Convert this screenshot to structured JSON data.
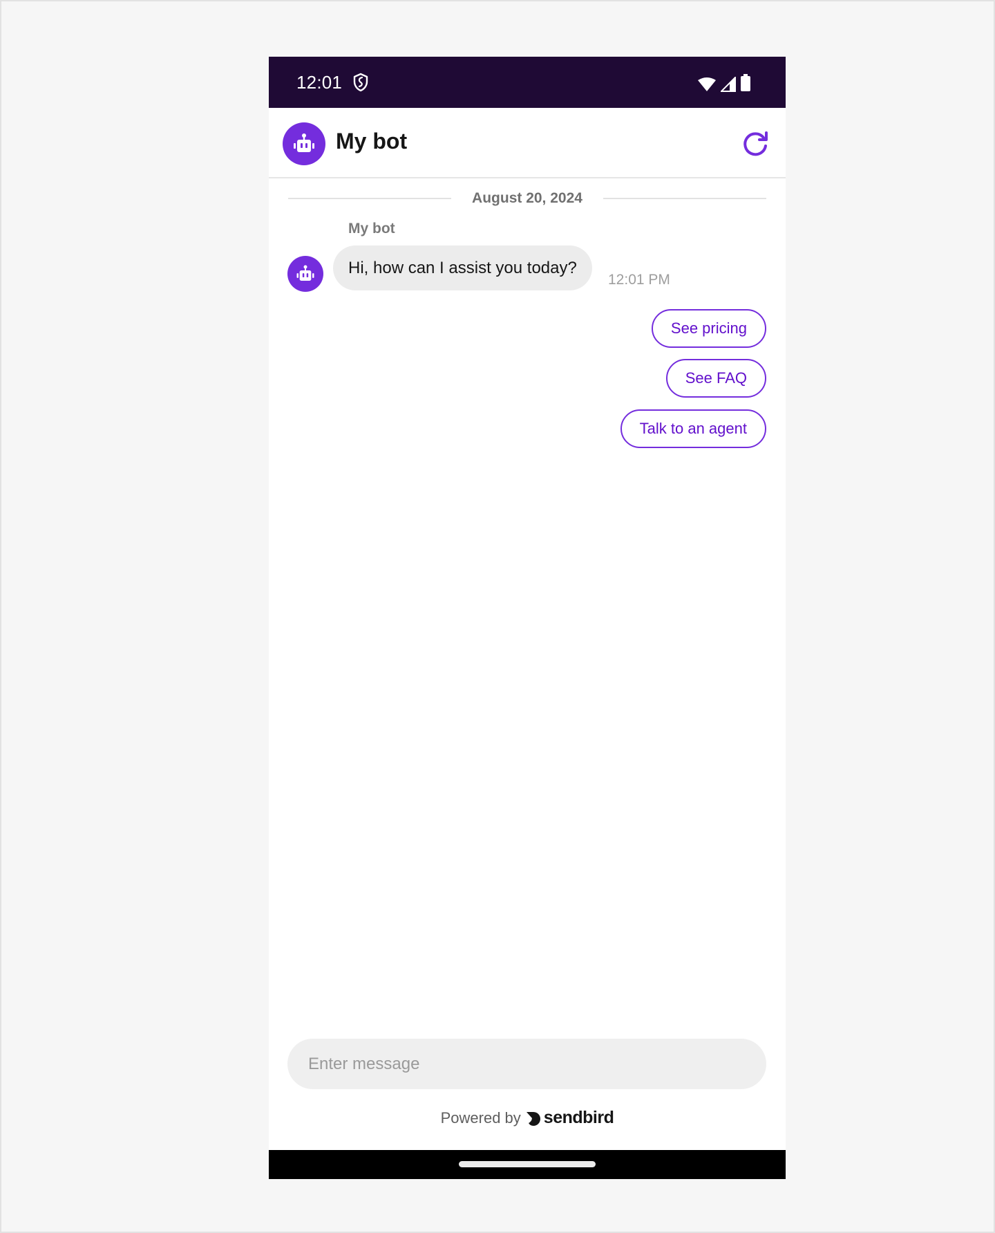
{
  "status_bar": {
    "time": "12:01",
    "icons": [
      "shield-icon",
      "wifi-icon",
      "cellular-signal-icon",
      "battery-icon"
    ],
    "background": "#1f0a35"
  },
  "header": {
    "title": "My bot",
    "avatar_icon": "robot-icon",
    "action_icon": "refresh-icon"
  },
  "chat": {
    "date_separator": "August 20, 2024",
    "messages": [
      {
        "sender": "My bot",
        "avatar_icon": "robot-icon",
        "text": "Hi, how can I assist you today?",
        "time": "12:01 PM"
      }
    ],
    "quick_replies": [
      {
        "label": "See pricing"
      },
      {
        "label": "See FAQ"
      },
      {
        "label": "Talk to an agent"
      }
    ]
  },
  "composer": {
    "value": "",
    "placeholder": "Enter message"
  },
  "footer": {
    "powered_by": "Powered by",
    "brand": "sendbird",
    "brand_icon": "sendbird-logo-icon"
  },
  "colors": {
    "accent": "#742ddd",
    "accent_text": "#6210cc",
    "bubble_bg": "#ececec",
    "input_bg": "#efefef"
  }
}
